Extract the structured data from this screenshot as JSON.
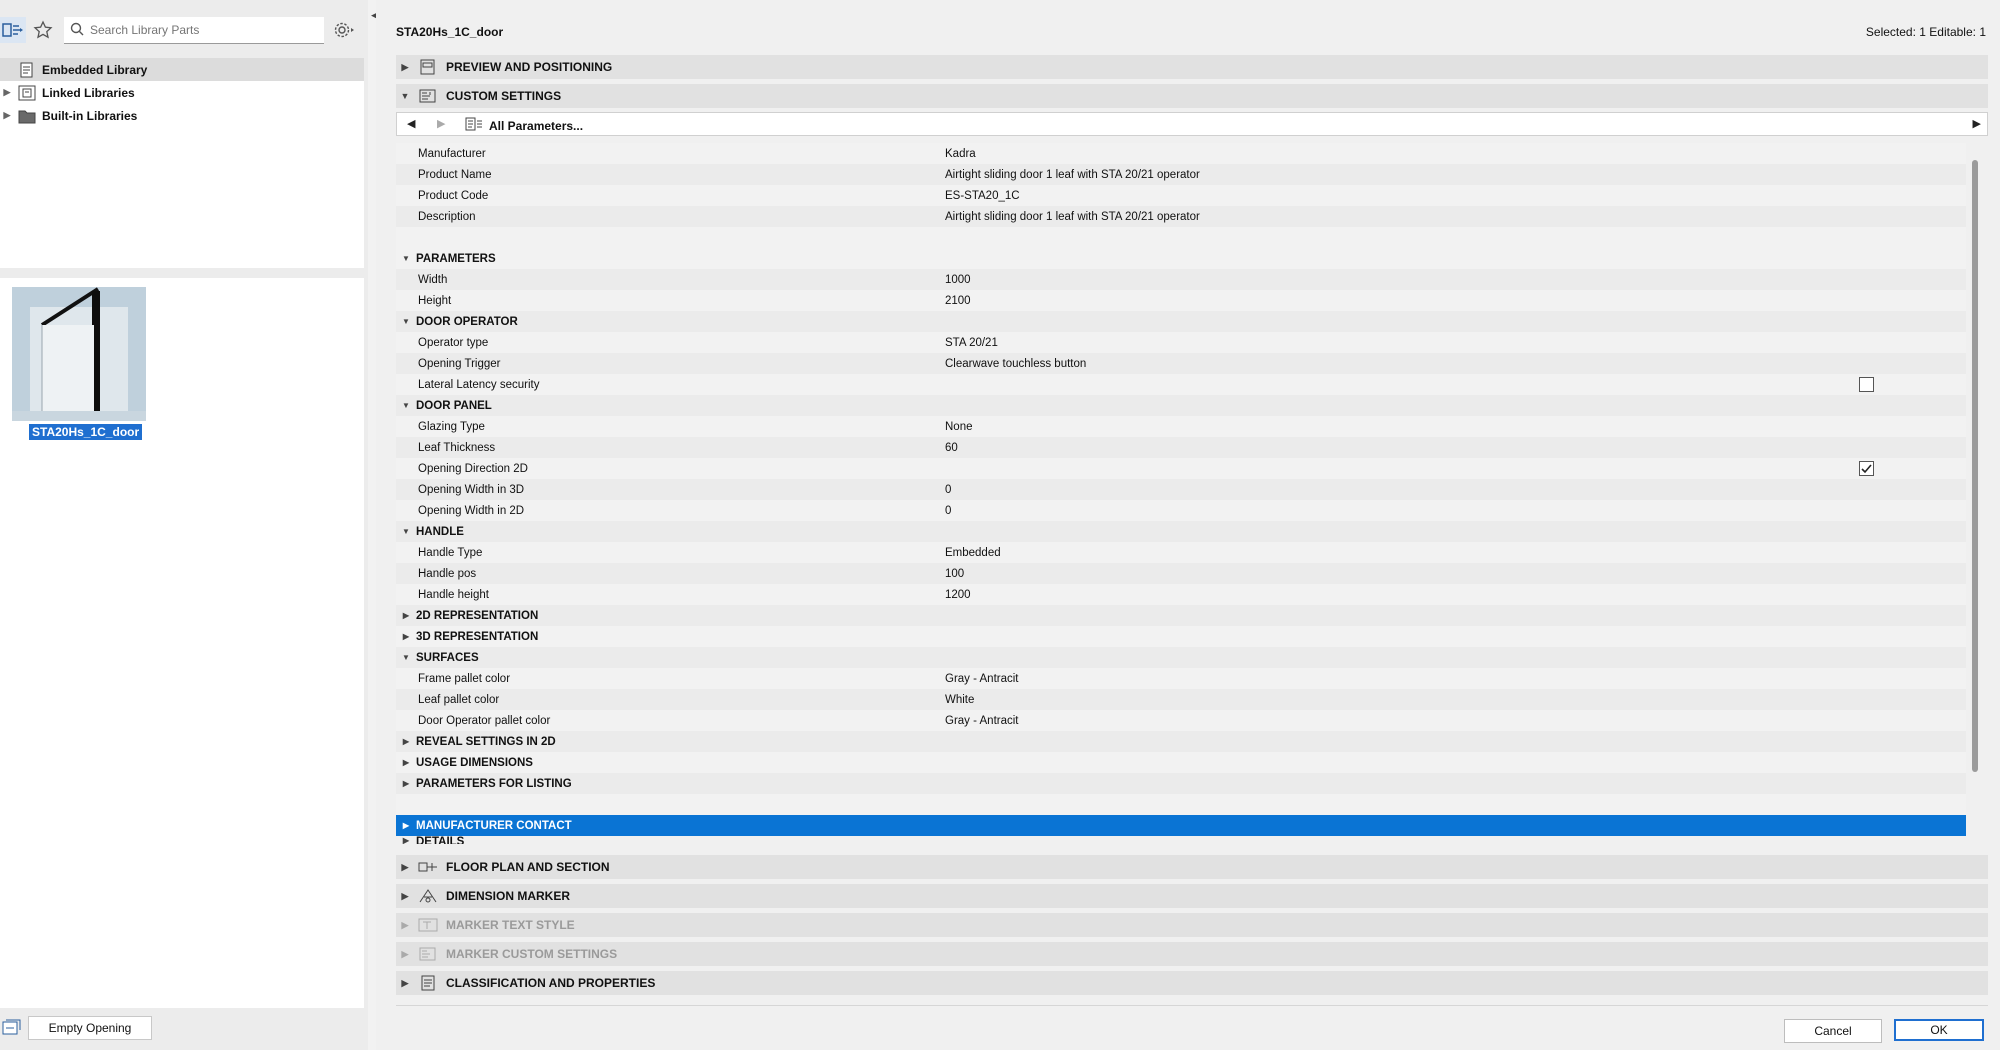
{
  "left": {
    "search_placeholder": "Search Library Parts",
    "tree": [
      {
        "label": "Embedded Library",
        "selected": true
      },
      {
        "label": "Linked Libraries",
        "selected": false
      },
      {
        "label": "Built-in Libraries",
        "selected": false
      }
    ],
    "thumbnail_label": "STA20Hs_1C_door",
    "empty_opening": "Empty Opening"
  },
  "header": {
    "title": "STA20Hs_1C_door",
    "selected": "Selected: 1 Editable: 1"
  },
  "sections": {
    "preview": "PREVIEW AND POSITIONING",
    "custom": "CUSTOM SETTINGS",
    "floor_plan": "FLOOR PLAN AND SECTION",
    "dimension_marker": "DIMENSION MARKER",
    "marker_text": "MARKER TEXT STYLE",
    "marker_custom": "MARKER CUSTOM SETTINGS",
    "classification": "CLASSIFICATION AND PROPERTIES"
  },
  "nav": {
    "all_params": "All Parameters..."
  },
  "params": {
    "info": [
      {
        "name": "Manufacturer",
        "value": "Kadra"
      },
      {
        "name": "Product Name",
        "value": "Airtight sliding door 1 leaf with STA 20/21 operator"
      },
      {
        "name": "Product Code",
        "value": "ES-STA20_1C"
      },
      {
        "name": "Description",
        "value": "Airtight sliding door 1 leaf with STA 20/21 operator"
      }
    ],
    "groups": {
      "parameters": "PARAMETERS",
      "door_operator": "DOOR OPERATOR",
      "door_panel": "DOOR PANEL",
      "handle": "HANDLE",
      "rep2d": "2D REPRESENTATION",
      "rep3d": "3D REPRESENTATION",
      "surfaces": "SURFACES",
      "reveal": "REVEAL SETTINGS IN 2D",
      "usage": "USAGE DIMENSIONS",
      "listing": "PARAMETERS FOR LISTING",
      "manufacturer_contact": "MANUFACTURER CONTACT",
      "details": "DETAILS"
    },
    "width": {
      "name": "Width",
      "value": "1000"
    },
    "height": {
      "name": "Height",
      "value": "2100"
    },
    "operator_type": {
      "name": "Operator type",
      "value": "STA 20/21"
    },
    "opening_trigger": {
      "name": "Opening Trigger",
      "value": "Clearwave touchless button"
    },
    "lateral": {
      "name": "Lateral Latency security"
    },
    "glazing": {
      "name": "Glazing Type",
      "value": "None"
    },
    "leaf_thickness": {
      "name": "Leaf Thickness",
      "value": "60"
    },
    "opening_dir": {
      "name": "Opening Direction 2D"
    },
    "open_w3d": {
      "name": "Opening Width in 3D",
      "value": "0"
    },
    "open_w2d": {
      "name": "Opening Width in 2D",
      "value": "0"
    },
    "handle_type": {
      "name": "Handle Type",
      "value": "Embedded"
    },
    "handle_pos": {
      "name": "Handle pos",
      "value": "100"
    },
    "handle_height": {
      "name": "Handle height",
      "value": "1200"
    },
    "frame_color": {
      "name": "Frame pallet color",
      "value": "Gray - Antracit"
    },
    "leaf_color": {
      "name": "Leaf pallet color",
      "value": "White"
    },
    "operator_color": {
      "name": "Door Operator pallet color",
      "value": "Gray - Antracit"
    }
  },
  "buttons": {
    "cancel": "Cancel",
    "ok": "OK"
  },
  "colors": {
    "accent": "#0a74d4",
    "selection_label": "#1f6fd0"
  }
}
